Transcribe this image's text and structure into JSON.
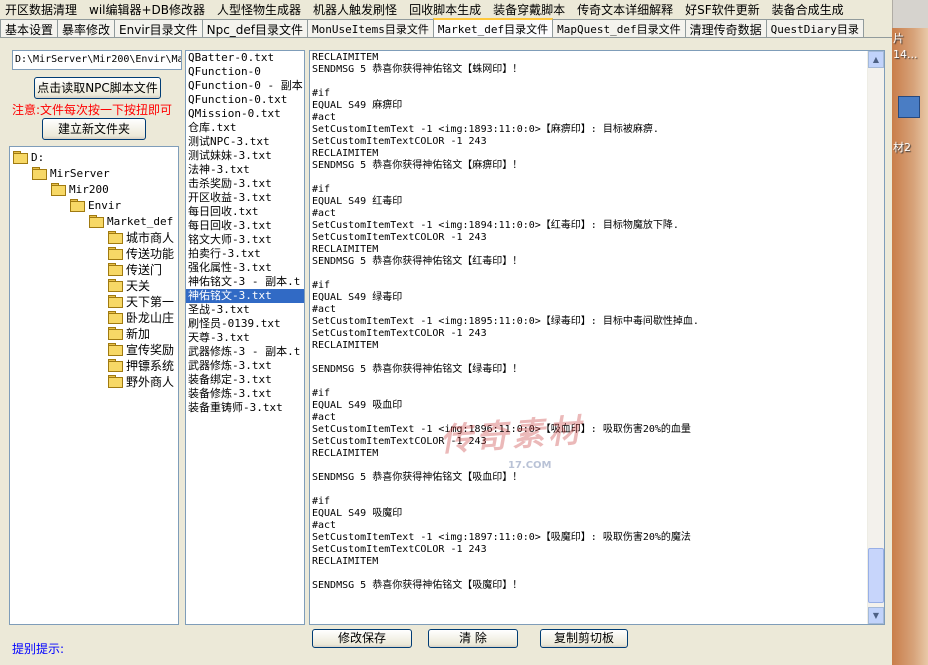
{
  "menu": [
    "开区数据清理",
    "wil编辑器+DB修改器",
    "人型怪物生成器",
    "机器人触发刷怪",
    "回收脚本生成",
    "装备穿戴脚本",
    "传奇文本详细解释",
    "好SF软件更新",
    "装备合成生成"
  ],
  "tabs": [
    {
      "label": "基本设置",
      "mono": false,
      "active": false
    },
    {
      "label": "暴率修改",
      "mono": false,
      "active": false
    },
    {
      "label": "Envir目录文件",
      "mono": false,
      "active": false
    },
    {
      "label": "Npc_def目录文件",
      "mono": false,
      "active": false
    },
    {
      "label": "MonUseItems目录文件",
      "mono": true,
      "active": false
    },
    {
      "label": "Market_def目录文件",
      "mono": true,
      "active": true
    },
    {
      "label": "MapQuest_def目录文件",
      "mono": true,
      "active": false
    },
    {
      "label": "清理传奇数据",
      "mono": false,
      "active": false
    },
    {
      "label": "QuestDiary目录",
      "mono": true,
      "active": false
    }
  ],
  "path_value": "D:\\MirServer\\Mir200\\Envir\\Market_def",
  "read_button": "点击读取NPC脚本文件",
  "note": "注意:文件每次按一下按扭即可",
  "newdir_button": "建立新文件夹",
  "tree": {
    "root": "D:",
    "l1": "MirServer",
    "l2": "Mir200",
    "l3": "Envir",
    "l4": "Market_def",
    "children": [
      "城市商人",
      "传送功能",
      "传送门",
      "天关",
      "天下第一",
      "卧龙山庄",
      "新加",
      "宣传奖励",
      "押镖系统",
      "野外商人"
    ]
  },
  "files": [
    "QBatter-0.txt",
    "QFunction-0",
    "QFunction-0 - 副本.t",
    "QFunction-0.txt",
    "QMission-0.txt",
    "仓库.txt",
    "测试NPC-3.txt",
    "测试妹妹-3.txt",
    "法神-3.txt",
    "击杀奖励-3.txt",
    "开区收益-3.txt",
    "每日回收.txt",
    "每日回收-3.txt",
    "铭文大师-3.txt",
    "拍卖行-3.txt",
    "强化属性-3.txt",
    "神佑铭文-3 - 副本.t",
    "神佑铭文-3.txt",
    "圣战-3.txt",
    "刷怪员-0139.txt",
    "天尊-3.txt",
    "武器修炼-3 - 副本.t",
    "武器修炼-3.txt",
    "装备绑定-3.txt",
    "装备修炼-3.txt",
    "装备重铸师-3.txt"
  ],
  "selected_file_index": 17,
  "editor_lines": [
    "RECLAIMITEM",
    "SENDMSG 5 恭喜你获得神佑铭文【蛛网印】！",
    "",
    "#if",
    "EQUAL S49 麻痹印",
    "#act",
    "SetCustomItemText -1 <img:1893:11:0:0>【麻痹印】: 目标被麻痹.",
    "SetCustomItemTextCOLOR -1 243",
    "RECLAIMITEM",
    "SENDMSG 5 恭喜你获得神佑铭文【麻痹印】！",
    "",
    "#if",
    "EQUAL S49 红毒印",
    "#act",
    "SetCustomItemText -1 <img:1894:11:0:0>【红毒印】: 目标物魔放下降.",
    "SetCustomItemTextCOLOR -1 243",
    "RECLAIMITEM",
    "SENDMSG 5 恭喜你获得神佑铭文【红毒印】！",
    "",
    "#if",
    "EQUAL S49 绿毒印",
    "#act",
    "SetCustomItemText -1 <img:1895:11:0:0>【绿毒印】: 目标中毒间歇性掉血.",
    "SetCustomItemTextCOLOR -1 243",
    "RECLAIMITEM",
    "",
    "SENDMSG 5 恭喜你获得神佑铭文【绿毒印】！",
    "",
    "#if",
    "EQUAL S49 吸血印",
    "#act",
    "SetCustomItemText -1 <img:1896:11:0:0>【吸血印】: 吸取伤害20%的血量",
    "SetCustomItemTextCOLOR -1 243",
    "RECLAIMITEM",
    "",
    "SENDMSG 5 恭喜你获得神佑铭文【吸血印】！",
    "",
    "#if",
    "EQUAL S49 吸魔印",
    "#act",
    "SetCustomItemText -1 <img:1897:11:0:0>【吸魔印】: 吸取伤害20%的魔法",
    "SetCustomItemTextCOLOR -1 243",
    "RECLAIMITEM",
    "",
    "SENDMSG 5 恭喜你获得神佑铭文【吸魔印】！"
  ],
  "buttons": {
    "save": "修改保存",
    "clear": "清 除",
    "copy": "复制剪切板"
  },
  "hint": "提别提示:",
  "watermark": "传奇素材",
  "watermark_sub": "17.COM",
  "desktop": {
    "texts": [
      "片",
      "14...",
      "材2"
    ]
  },
  "colors": {
    "note": "#ff0000",
    "hint": "#0000ff",
    "selection": "#316ac5",
    "tab_active_accent": "#ffc83c"
  }
}
